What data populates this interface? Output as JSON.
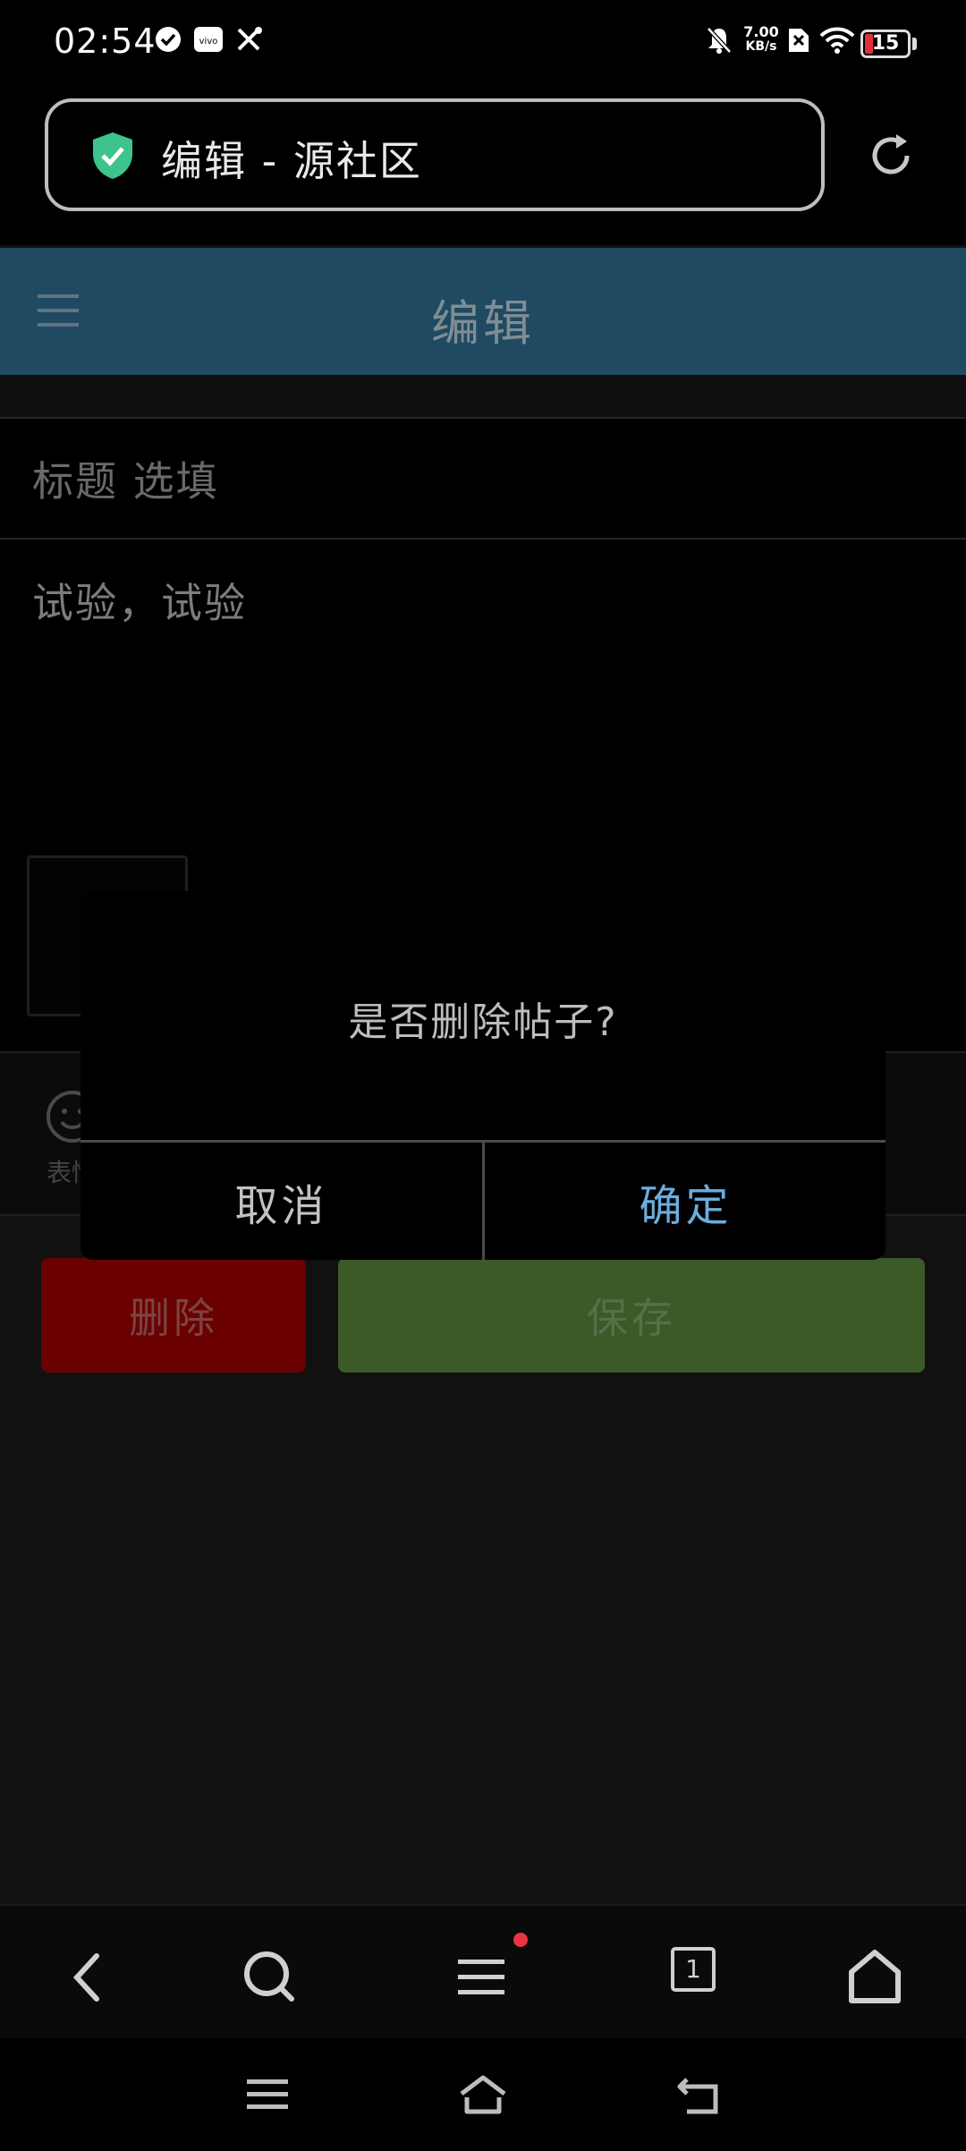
{
  "status_bar": {
    "time": "02:54",
    "net_speed_value": "7.00",
    "net_speed_unit": "KB/s",
    "battery_level": "15",
    "icons": [
      "check-circle-icon",
      "vivo-icon",
      "tools-icon",
      "bell-off-icon",
      "sim-x-icon",
      "wifi-icon",
      "battery-icon"
    ]
  },
  "browser": {
    "page_title": "编辑 - 源社区",
    "secure_icon": "shield-check-icon",
    "reload_icon": "reload-icon"
  },
  "app_header": {
    "title": "编辑",
    "menu_icon": "hamburger-icon"
  },
  "editor": {
    "title_placeholder": "标题  选填",
    "body_text": "试验，试验",
    "emoji_label": "表情"
  },
  "actions": {
    "delete_label": "删除",
    "save_label": "保存"
  },
  "dialog": {
    "message": "是否删除帖子?",
    "cancel_label": "取消",
    "confirm_label": "确定"
  },
  "browser_nav": {
    "tab_count": "1",
    "icons": [
      "back-icon",
      "search-icon",
      "menu-icon",
      "tabs-icon",
      "home-icon"
    ]
  },
  "colors": {
    "header_bg": "#1f4a61",
    "delete_bg": "#6a0000",
    "save_bg": "#3c5928",
    "confirm_text": "#6aaee0",
    "badge": "#ee3344",
    "shield": "#3cc48a"
  }
}
